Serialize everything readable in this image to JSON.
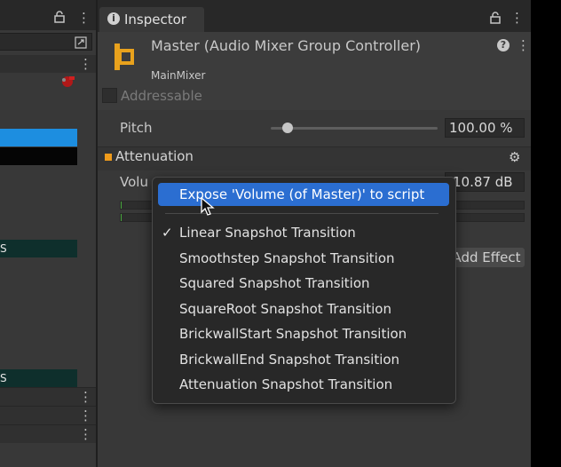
{
  "left_panel": {
    "teal_label_1": "S",
    "teal_label_2": "S"
  },
  "inspector": {
    "tab_label": "Inspector",
    "object_title": "Master (Audio Mixer Group Controller)",
    "object_subtitle": "MainMixer",
    "addressable_label": "Addressable",
    "addressable_checked": false,
    "pitch_label": "Pitch",
    "pitch_value": "100.00 %",
    "pitch_slider_fraction": 0.1,
    "attenuation_label": "Attenuation",
    "volume_label": "Volu",
    "volume_value": "10.87 dB",
    "add_effect_label": "Add Effect"
  },
  "context_menu": {
    "items": [
      {
        "label": "Expose 'Volume (of Master)' to script",
        "highlighted": true
      },
      {
        "label": "Linear Snapshot Transition",
        "checked": true
      },
      {
        "label": "Smoothstep Snapshot Transition"
      },
      {
        "label": "Squared Snapshot Transition"
      },
      {
        "label": "SquareRoot Snapshot Transition"
      },
      {
        "label": "BrickwallStart Snapshot Transition"
      },
      {
        "label": "BrickwallEnd Snapshot Transition"
      },
      {
        "label": "Attenuation Snapshot Transition"
      }
    ],
    "check_mark": "✓"
  },
  "colors": {
    "accent_highlight": "#2b6ed1",
    "selection_blue": "#1d8ee0",
    "attenuation_marker": "#f09b1b"
  },
  "icons": [
    "lock-icon",
    "more-options-icon",
    "info-icon",
    "mixer-group-icon",
    "help-icon",
    "gear-icon",
    "mouse-cursor-icon"
  ]
}
